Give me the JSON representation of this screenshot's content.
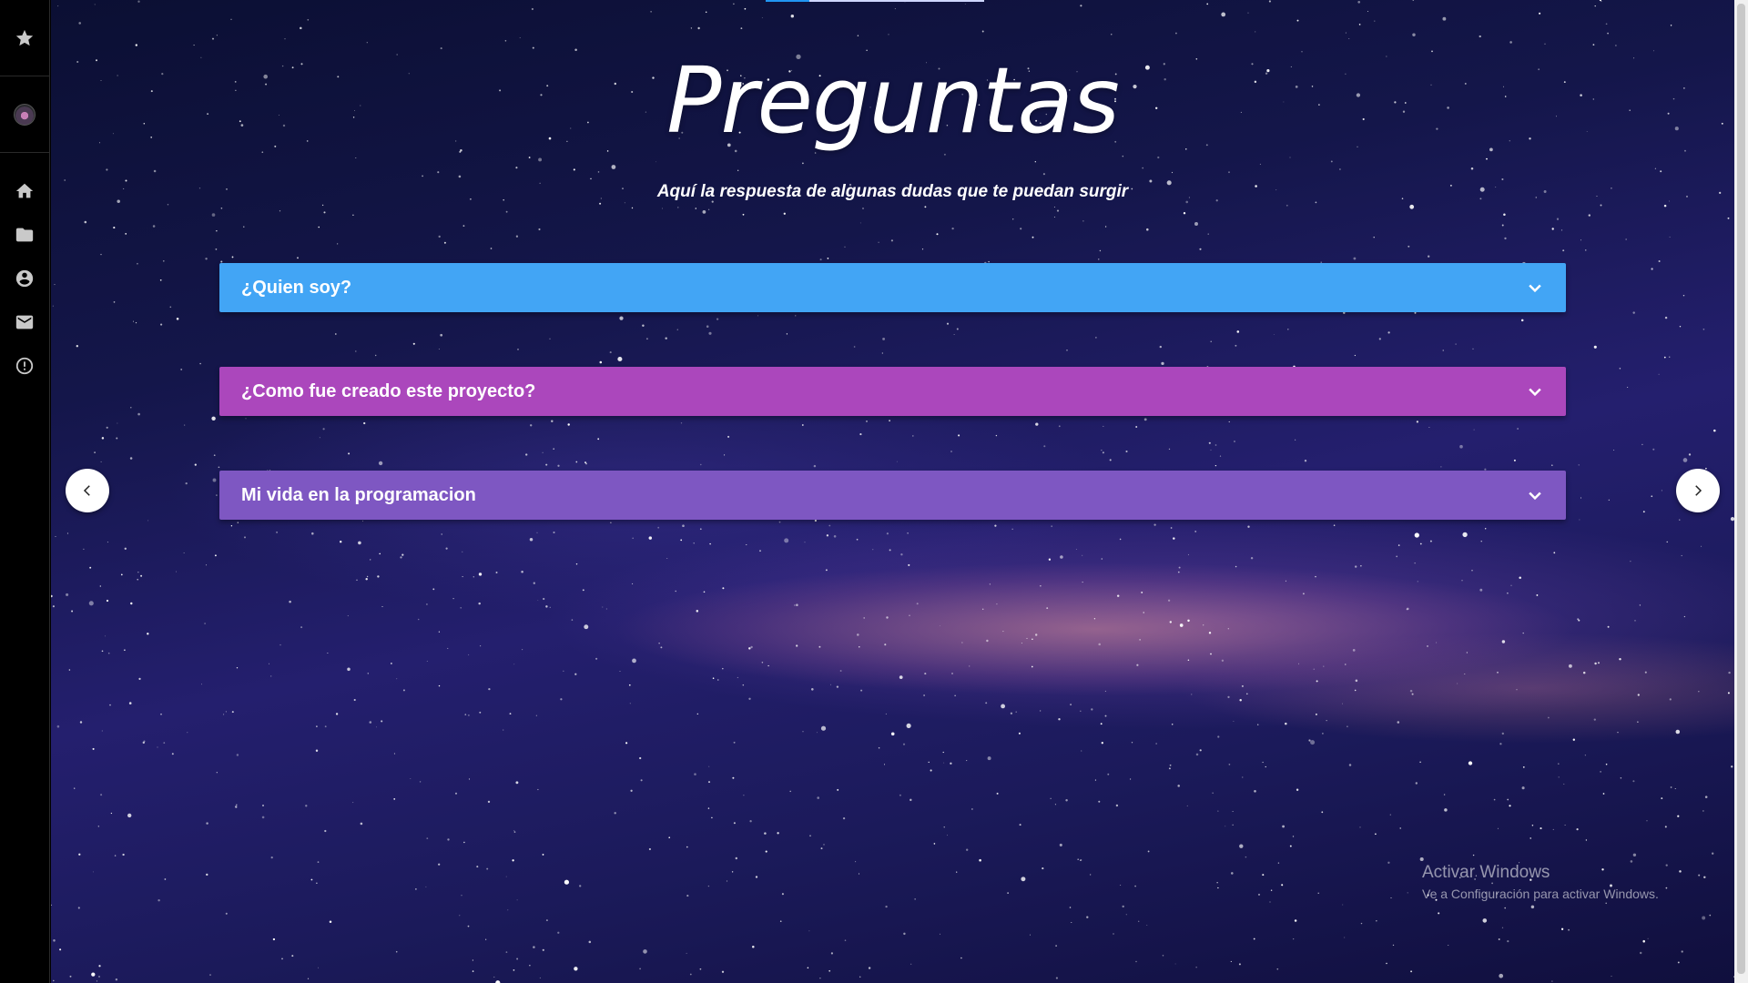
{
  "page": {
    "title": "Preguntas",
    "subtitle": "Aquí la respuesta de algunas dudas que te puedan surgir"
  },
  "sidebar": {
    "icons": [
      "star-icon",
      "avatar",
      "home-icon",
      "folder-icon",
      "account-icon",
      "mail-icon",
      "alert-icon"
    ]
  },
  "faq": [
    {
      "question": "¿Quien soy?",
      "color": "#42a5f5"
    },
    {
      "question": "¿Como fue creado este proyecto?",
      "color": "#ab47bc"
    },
    {
      "question": "Mi vida en la programacion",
      "color": "#7e57c2"
    }
  ],
  "watermark": {
    "line1": "Activar Windows",
    "line2": "Ve a Configuración para activar Windows."
  }
}
